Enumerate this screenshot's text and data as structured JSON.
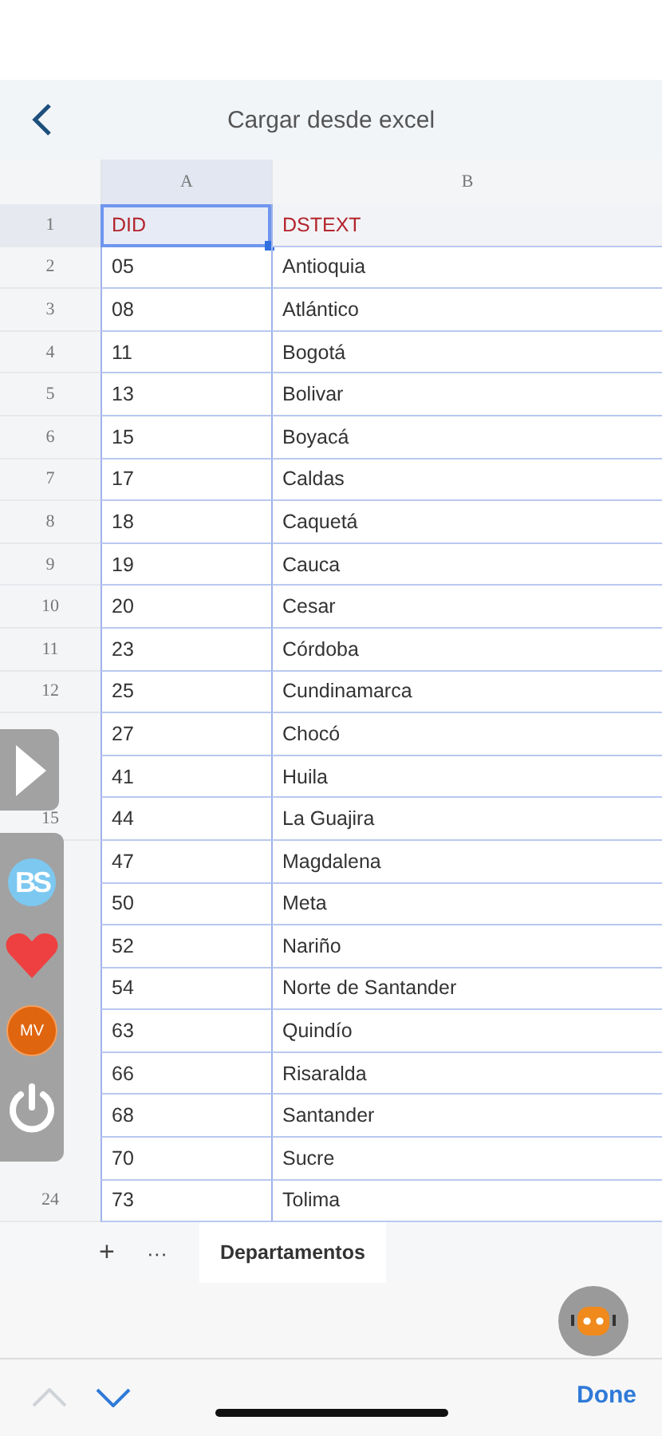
{
  "header": {
    "title": "Cargar desde excel"
  },
  "sheet": {
    "columns": [
      {
        "label": "A",
        "selected": true
      },
      {
        "label": "B",
        "selected": false
      }
    ],
    "rows": [
      {
        "num": "1",
        "kind": "header",
        "cells": [
          {
            "text": "DID",
            "selected": true
          },
          {
            "text": "DSTEXT",
            "selected": false
          }
        ]
      },
      {
        "num": "2",
        "kind": "data",
        "cells": [
          {
            "text": "05",
            "selected": false
          },
          {
            "text": "Antioquia",
            "selected": false
          }
        ]
      },
      {
        "num": "3",
        "kind": "data",
        "cells": [
          {
            "text": "08",
            "selected": false
          },
          {
            "text": "Atlántico",
            "selected": false
          }
        ]
      },
      {
        "num": "4",
        "kind": "data",
        "cells": [
          {
            "text": "11",
            "selected": false
          },
          {
            "text": "Bogotá",
            "selected": false
          }
        ]
      },
      {
        "num": "5",
        "kind": "data",
        "cells": [
          {
            "text": "13",
            "selected": false
          },
          {
            "text": "Bolivar",
            "selected": false
          }
        ]
      },
      {
        "num": "6",
        "kind": "data",
        "cells": [
          {
            "text": "15",
            "selected": false
          },
          {
            "text": "Boyacá",
            "selected": false
          }
        ]
      },
      {
        "num": "7",
        "kind": "data",
        "cells": [
          {
            "text": "17",
            "selected": false
          },
          {
            "text": "Caldas",
            "selected": false
          }
        ]
      },
      {
        "num": "8",
        "kind": "data",
        "cells": [
          {
            "text": "18",
            "selected": false
          },
          {
            "text": "Caquetá",
            "selected": false
          }
        ]
      },
      {
        "num": "9",
        "kind": "data",
        "cells": [
          {
            "text": "19",
            "selected": false
          },
          {
            "text": "Cauca",
            "selected": false
          }
        ]
      },
      {
        "num": "10",
        "kind": "data",
        "cells": [
          {
            "text": "20",
            "selected": false
          },
          {
            "text": "Cesar",
            "selected": false
          }
        ]
      },
      {
        "num": "11",
        "kind": "data",
        "cells": [
          {
            "text": "23",
            "selected": false
          },
          {
            "text": "Córdoba",
            "selected": false
          }
        ]
      },
      {
        "num": "12",
        "kind": "data",
        "cells": [
          {
            "text": "25",
            "selected": false
          },
          {
            "text": "Cundinamarca",
            "selected": false
          }
        ]
      },
      {
        "kind": "data",
        "cells": [
          {
            "text": "27",
            "selected": false
          },
          {
            "text": "Chocó",
            "selected": false
          }
        ]
      },
      {
        "kind": "data",
        "cells": [
          {
            "text": "41",
            "selected": false
          },
          {
            "text": "Huila",
            "selected": false
          }
        ]
      },
      {
        "num": "15",
        "kind": "data",
        "cells": [
          {
            "text": "44",
            "selected": false
          },
          {
            "text": "La Guajira",
            "selected": false
          }
        ]
      },
      {
        "kind": "data",
        "cells": [
          {
            "text": "47",
            "selected": false
          },
          {
            "text": "Magdalena",
            "selected": false
          }
        ]
      },
      {
        "kind": "data",
        "cells": [
          {
            "text": "50",
            "selected": false
          },
          {
            "text": "Meta",
            "selected": false
          }
        ]
      },
      {
        "kind": "data",
        "cells": [
          {
            "text": "52",
            "selected": false
          },
          {
            "text": "Nariño",
            "selected": false
          }
        ]
      },
      {
        "kind": "data",
        "cells": [
          {
            "text": "54",
            "selected": false
          },
          {
            "text": "Norte de Santander",
            "selected": false
          }
        ]
      },
      {
        "kind": "data",
        "cells": [
          {
            "text": "63",
            "selected": false
          },
          {
            "text": "Quindío",
            "selected": false
          }
        ]
      },
      {
        "kind": "data",
        "cells": [
          {
            "text": "66",
            "selected": false
          },
          {
            "text": "Risaralda",
            "selected": false
          }
        ]
      },
      {
        "kind": "data",
        "cells": [
          {
            "text": "68",
            "selected": false
          },
          {
            "text": "Santander",
            "selected": false
          }
        ]
      },
      {
        "kind": "data",
        "cells": [
          {
            "text": "70",
            "selected": false
          },
          {
            "text": "Sucre",
            "selected": false
          }
        ]
      },
      {
        "num": "24",
        "kind": "data",
        "cells": [
          {
            "text": "73",
            "selected": false
          },
          {
            "text": "Tolima",
            "selected": false
          }
        ]
      }
    ]
  },
  "sheet_tabs": {
    "add": "+",
    "more": "···",
    "tabs": [
      {
        "label": "Departamentos",
        "selected": true
      }
    ]
  },
  "side_panel": {
    "bs_badge": "BS",
    "mv_badge": "MV"
  },
  "toolbar": {
    "prev_disabled": true,
    "next_disabled": false,
    "done": "Done"
  }
}
